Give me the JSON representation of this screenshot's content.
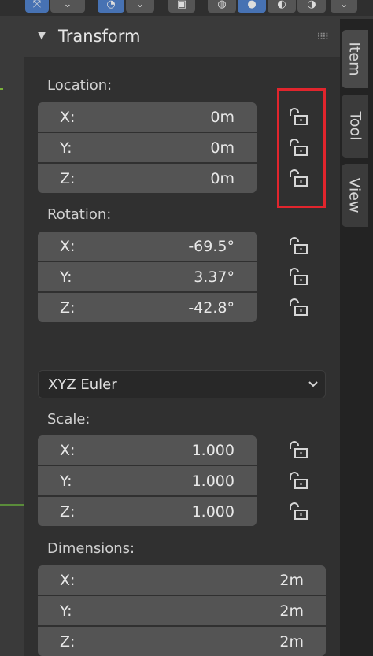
{
  "panel": {
    "title": "Transform"
  },
  "tabs": [
    "Item",
    "Tool",
    "View"
  ],
  "location": {
    "label": "Location:",
    "rows": [
      {
        "axis": "X:",
        "value": "0m"
      },
      {
        "axis": "Y:",
        "value": "0m"
      },
      {
        "axis": "Z:",
        "value": "0m"
      }
    ]
  },
  "rotation": {
    "label": "Rotation:",
    "rows": [
      {
        "axis": "X:",
        "value": "-69.5°"
      },
      {
        "axis": "Y:",
        "value": "3.37°"
      },
      {
        "axis": "Z:",
        "value": "-42.8°"
      }
    ],
    "mode": "XYZ Euler"
  },
  "scale": {
    "label": "Scale:",
    "rows": [
      {
        "axis": "X:",
        "value": "1.000"
      },
      {
        "axis": "Y:",
        "value": "1.000"
      },
      {
        "axis": "Z:",
        "value": "1.000"
      }
    ]
  },
  "dimensions": {
    "label": "Dimensions:",
    "rows": [
      {
        "axis": "X:",
        "value": "2m"
      },
      {
        "axis": "Y:",
        "value": "2m"
      },
      {
        "axis": "Z:",
        "value": "2m"
      }
    ]
  },
  "colors": {
    "accent": "#4772b3",
    "highlight": "#e1252d",
    "field": "#545454"
  }
}
